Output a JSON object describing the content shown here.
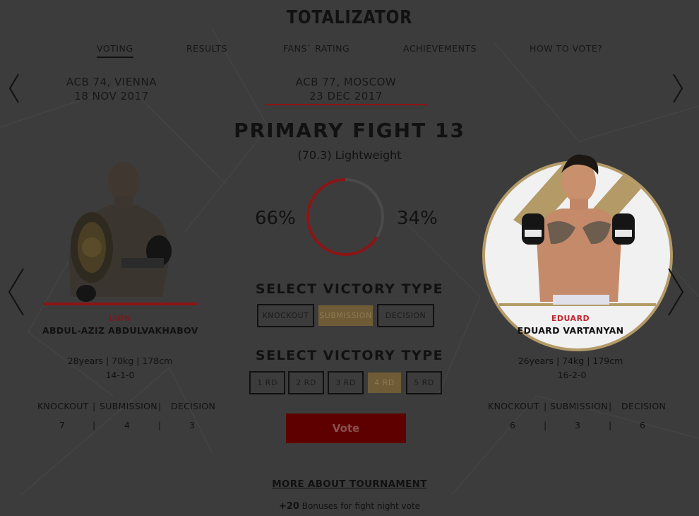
{
  "app": {
    "title": "TOTALIZATOR"
  },
  "nav": {
    "items": [
      "VOTING",
      "RESULTS",
      "FANS` RATING",
      "ACHIEVEMENTS",
      "HOW TO VOTE?"
    ],
    "active_index": 0
  },
  "events": {
    "previous": {
      "line1": "ACB 74, VIENNA",
      "line2": "18 NOV 2017"
    },
    "current": {
      "line1": "ACB 77, MOSCOW",
      "line2": "23 DEC 2017"
    }
  },
  "fight": {
    "title": "PRIMARY FIGHT 13",
    "weight_class": "(70.3) Lightweight",
    "left_percent": "66%",
    "right_percent": "34%",
    "left_share": 0.66
  },
  "victory_type": {
    "title": "SELECT VICTORY TYPE",
    "options": [
      "KNOCKOUT",
      "SUBMISSION",
      "DECISION"
    ],
    "selected": "SUBMISSION"
  },
  "round": {
    "title": "SELECT VICTORY TYPE",
    "options": [
      "1 RD",
      "2 RD",
      "3 RD",
      "4 RD",
      "5 RD"
    ],
    "selected": "4 RD"
  },
  "vote_label": "Vote",
  "more_link": "MORE ABOUT TOURNAMENT",
  "bonus": {
    "amount": "+20",
    "text": " Bonuses for fight night vote"
  },
  "fighters": {
    "left": {
      "nickname": "LION",
      "name": "ABDUL-AZIZ ABDULVAKHABOV",
      "stats": "28years | 70kg | 178cm",
      "record": "14-1-0",
      "headers": [
        "KNOCKOUT",
        "SUBMISSION",
        "DECISION"
      ],
      "values": [
        "7",
        "4",
        "3"
      ]
    },
    "right": {
      "nickname": "EDUARD",
      "name": "EDUARD VARTANYAN",
      "stats": "26years | 74kg | 179cm",
      "record": "16-2-0",
      "headers": [
        "KNOCKOUT",
        "SUBMISSION",
        "DECISION"
      ],
      "values": [
        "6",
        "3",
        "6"
      ]
    }
  },
  "colors": {
    "background": "#3c3c3c",
    "accent_red": "#8c1515",
    "nickname_red": "#c0262f",
    "gold": "#b39a67",
    "vote_bg": "#5f0000"
  },
  "icons": {
    "prev_event": "chevron-left-icon",
    "next_event": "chevron-right-icon",
    "prev_fight": "chevron-left-icon",
    "next_fight": "chevron-right-icon"
  }
}
